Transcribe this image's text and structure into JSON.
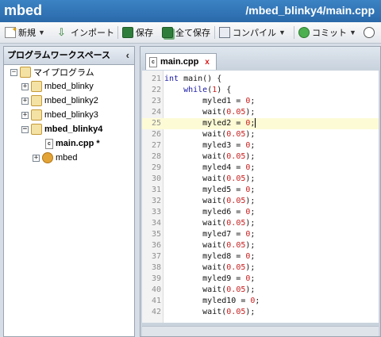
{
  "app": {
    "title": "mbed",
    "file_path": "/mbed_blinky4/main.cpp"
  },
  "toolbar": {
    "new_label": "新規",
    "import_label": "インポート",
    "save_label": "保存",
    "save_all_label": "全て保存",
    "compile_label": "コンパイル",
    "commit_label": "コミット"
  },
  "workspace": {
    "header": "プログラムワークスペース",
    "root": "マイプログラム",
    "items": [
      {
        "label": "mbed_blinky"
      },
      {
        "label": "mbed_blinky2"
      },
      {
        "label": "mbed_blinky3"
      },
      {
        "label": "mbed_blinky4"
      },
      {
        "label": "main.cpp *"
      },
      {
        "label": "mbed"
      }
    ]
  },
  "editor": {
    "tab_label": "main.cpp",
    "tab_close": "x",
    "lines": [
      {
        "num": "21",
        "code": "int main() {"
      },
      {
        "num": "22",
        "code": "    while(1) {"
      },
      {
        "num": "23",
        "code": "        myled1 = 0;"
      },
      {
        "num": "24",
        "code": "        wait(0.05);"
      },
      {
        "num": "25",
        "code": "        myled2 = 0;"
      },
      {
        "num": "26",
        "code": "        wait(0.05);"
      },
      {
        "num": "27",
        "code": "        myled3 = 0;"
      },
      {
        "num": "28",
        "code": "        wait(0.05);"
      },
      {
        "num": "29",
        "code": "        myled4 = 0;"
      },
      {
        "num": "30",
        "code": "        wait(0.05);"
      },
      {
        "num": "31",
        "code": "        myled5 = 0;"
      },
      {
        "num": "32",
        "code": "        wait(0.05);"
      },
      {
        "num": "33",
        "code": "        myled6 = 0;"
      },
      {
        "num": "34",
        "code": "        wait(0.05);"
      },
      {
        "num": "35",
        "code": "        myled7 = 0;"
      },
      {
        "num": "36",
        "code": "        wait(0.05);"
      },
      {
        "num": "37",
        "code": "        myled8 = 0;"
      },
      {
        "num": "38",
        "code": "        wait(0.05);"
      },
      {
        "num": "39",
        "code": "        myled9 = 0;"
      },
      {
        "num": "40",
        "code": "        wait(0.05);"
      },
      {
        "num": "41",
        "code": "        myled10 = 0;"
      },
      {
        "num": "42",
        "code": "        wait(0.05);"
      }
    ],
    "active_line": "25"
  }
}
